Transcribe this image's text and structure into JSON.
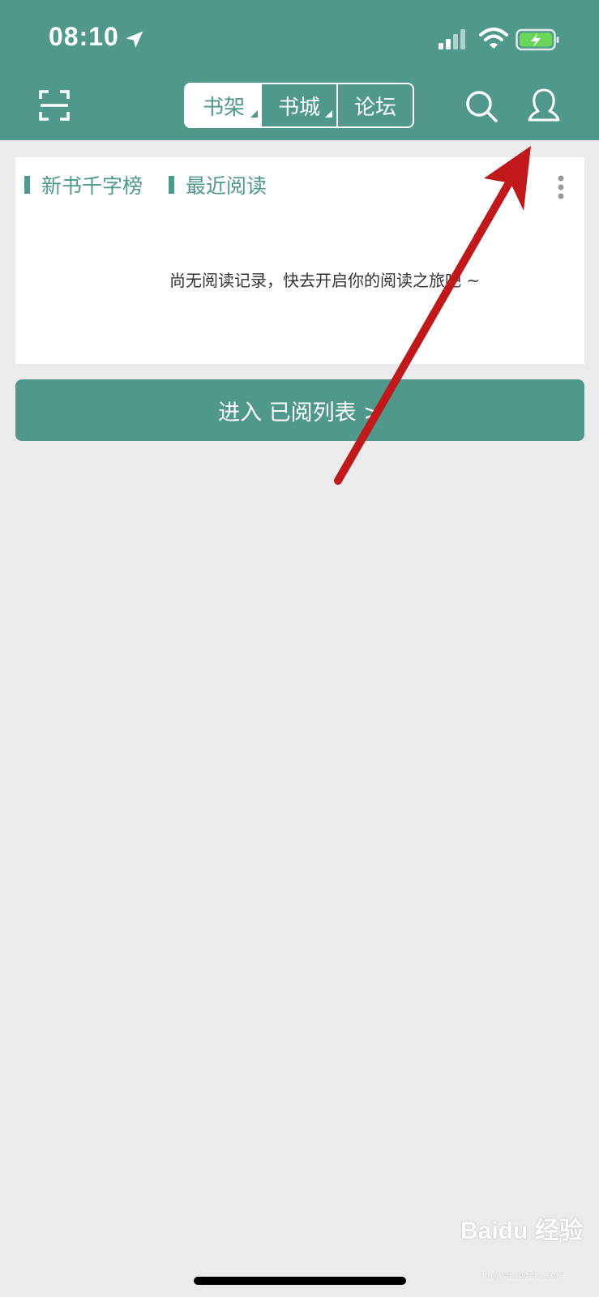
{
  "status_bar": {
    "time": "08:10"
  },
  "nav": {
    "tabs": [
      {
        "label": "书架"
      },
      {
        "label": "书城"
      },
      {
        "label": "论坛"
      }
    ]
  },
  "card": {
    "sections": [
      {
        "label": "新书千字榜"
      },
      {
        "label": "最近阅读"
      }
    ],
    "empty_message": "尚无阅读记录，快去开启你的阅读之旅吧 ~"
  },
  "enter_button": {
    "label": "进入 已阅列表 >"
  },
  "watermark": {
    "text": "Baidu 经验",
    "sub": "jingyan.baidu.com"
  },
  "icons": [
    "location-arrow-icon",
    "signal-icon",
    "wifi-icon",
    "battery-charging-icon",
    "scan-icon",
    "search-icon",
    "user-icon",
    "more-vertical-icon",
    "annotation-arrow"
  ],
  "colors": {
    "accent": "#4f988b",
    "background": "#ebebeb",
    "annotation": "#c0181b"
  }
}
